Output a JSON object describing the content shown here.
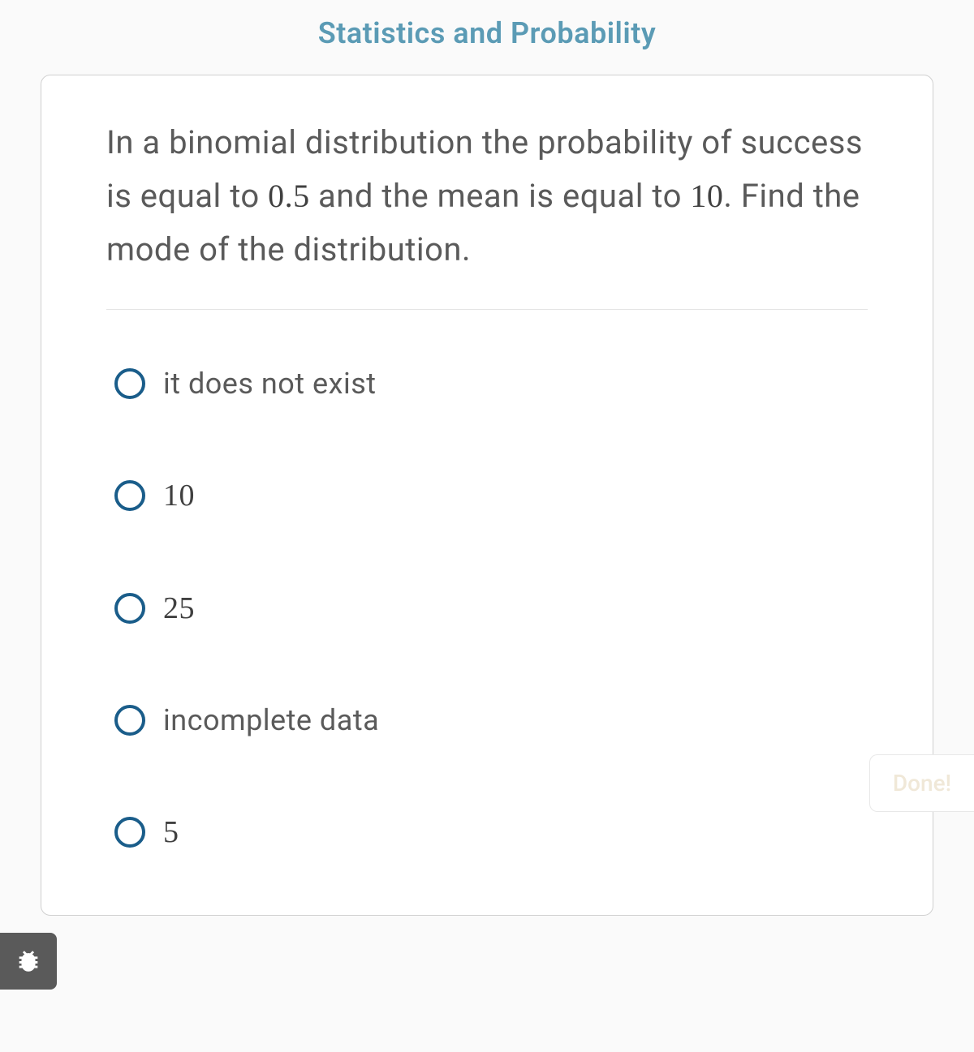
{
  "header": {
    "title": "Statistics and Probability"
  },
  "question": {
    "text_part1": "In a binomial distribution the probability of success is equal to ",
    "value1": "0.5",
    "text_part2": " and the mean is equal to ",
    "value2": "10",
    "text_part3": ". Find the mode of the distribution."
  },
  "options": [
    {
      "label": "it does not exist",
      "is_numeric": false
    },
    {
      "label": "10",
      "is_numeric": true
    },
    {
      "label": "25",
      "is_numeric": true
    },
    {
      "label": "incomplete data",
      "is_numeric": false
    },
    {
      "label": "5",
      "is_numeric": true
    }
  ],
  "side_tab": {
    "label": "Done!"
  },
  "bug_icon": "bug-icon"
}
